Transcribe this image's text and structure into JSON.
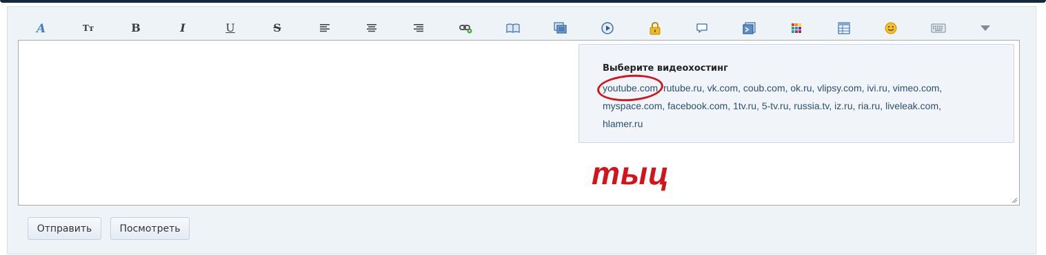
{
  "popup": {
    "title": "Выберите видеохостинг",
    "hosts": [
      "youtube.com",
      "rutube.ru",
      "vk.com",
      "coub.com",
      "ok.ru",
      "vlipsy.com",
      "ivi.ru",
      "vimeo.com",
      "myspace.com",
      "facebook.com",
      "1tv.ru",
      "5-tv.ru",
      "russia.tv",
      "iz.ru",
      "ria.ru",
      "liveleak.com",
      "hlamer.ru"
    ]
  },
  "annotation": {
    "text": "тыц",
    "color": "#d4141c"
  },
  "buttons": {
    "submit": "Отправить",
    "preview": "Посмотреть"
  },
  "toolbar": {
    "size_label": "Tт",
    "bold_label": "B",
    "italic_label": "I",
    "underline_label": "U",
    "strike_label": "S",
    "icons": [
      "font-color-icon",
      "font-size-icon",
      "bold-icon",
      "italic-icon",
      "underline-icon",
      "strikethrough-icon",
      "align-left-icon",
      "align-center-icon",
      "align-right-icon",
      "link-icon",
      "book-icon",
      "gallery-icon",
      "video-icon",
      "lock-icon",
      "speech-bubble-icon",
      "article-icon",
      "color-palette-icon",
      "table-icon",
      "smiley-icon",
      "keyboard-icon",
      "more-dropdown-icon"
    ]
  }
}
